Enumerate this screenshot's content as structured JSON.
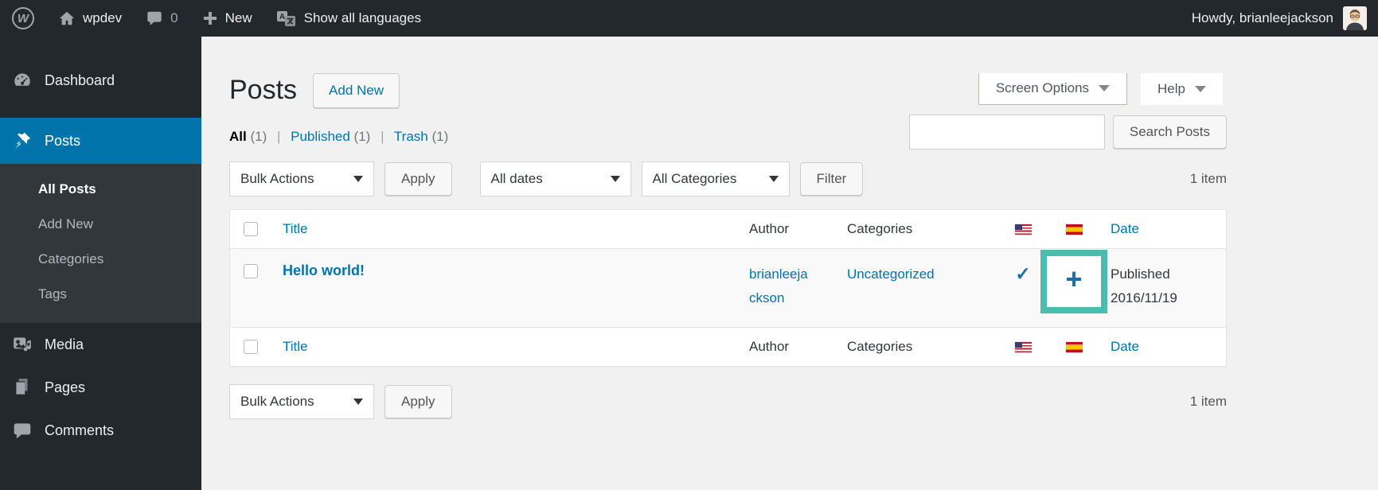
{
  "theme": {
    "accent": "#0073aa",
    "highlight_teal": "#4bbcad",
    "sidebar_bg": "#23282d"
  },
  "admin_bar": {
    "wp_logo_letter": "W",
    "site_name": "wpdev",
    "comments_count": "0",
    "new_label": "New",
    "languages_label": "Show all languages",
    "howdy_text": "Howdy, brianleejackson"
  },
  "sidebar": {
    "dashboard": "Dashboard",
    "posts": "Posts",
    "submenu": {
      "all_posts": "All Posts",
      "add_new": "Add New",
      "categories": "Categories",
      "tags": "Tags"
    },
    "media": "Media",
    "pages": "Pages",
    "comments": "Comments"
  },
  "screen_meta": {
    "screen_options": "Screen Options",
    "help": "Help"
  },
  "page": {
    "title": "Posts",
    "add_new_button": "Add New"
  },
  "views": {
    "all": "All",
    "all_count": "(1)",
    "published": "Published",
    "published_count": "(1)",
    "trash": "Trash",
    "trash_count": "(1)",
    "separator": "|"
  },
  "search": {
    "value": "",
    "button_label": "Search Posts"
  },
  "toolbar_top": {
    "bulk_actions": "Bulk Actions",
    "apply": "Apply",
    "all_dates": "All dates",
    "all_categories": "All Categories",
    "filter": "Filter",
    "item_count": "1 item"
  },
  "table": {
    "headers": {
      "title": "Title",
      "author": "Author",
      "categories": "Categories",
      "date": "Date"
    },
    "row": {
      "title": "Hello world!",
      "author": "brianleejackson",
      "categories": "Uncategorized",
      "english_translated_mark": "✓",
      "spanish_add_mark": "+",
      "status": "Published",
      "date": "2016/11/19"
    }
  },
  "toolbar_bottom": {
    "bulk_actions": "Bulk Actions",
    "apply": "Apply",
    "item_count": "1 item"
  }
}
